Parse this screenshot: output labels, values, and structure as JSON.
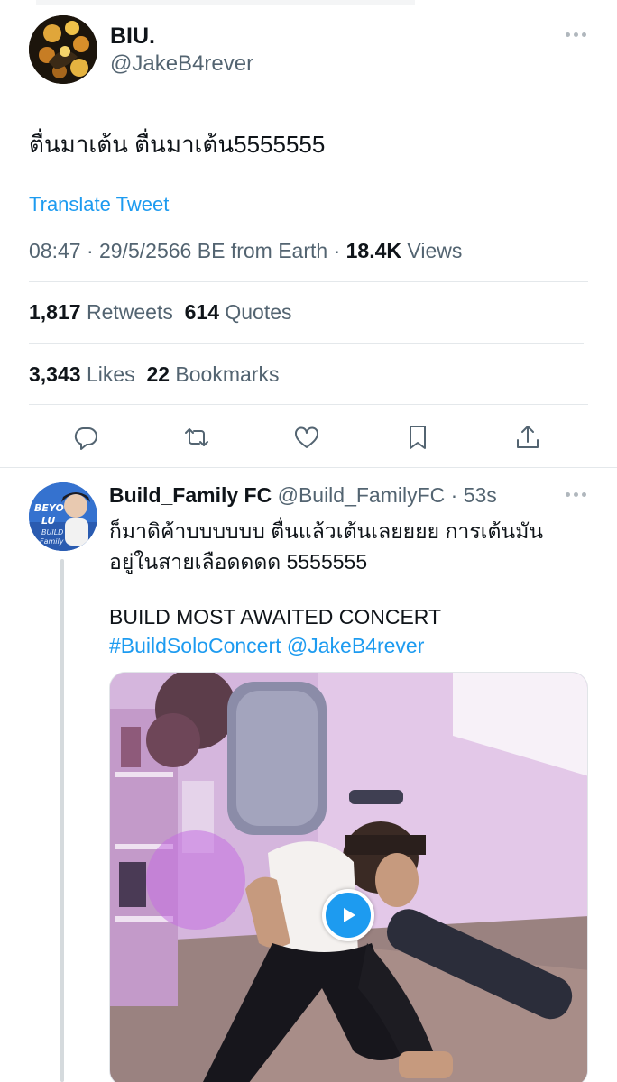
{
  "main_tweet": {
    "display_name": "BIU.",
    "handle": "@JakeB4rever",
    "text": "ตื่นมาเต้น ตื่นมาเต้น5555555",
    "translate_label": "Translate Tweet",
    "time": "08:47",
    "date": "29/5/2566 BE",
    "source": "from Earth",
    "views_count": "18.4K",
    "views_label": "Views",
    "retweets_count": "1,817",
    "retweets_label": "Retweets",
    "quotes_count": "614",
    "quotes_label": "Quotes",
    "likes_count": "3,343",
    "likes_label": "Likes",
    "bookmarks_count": "22",
    "bookmarks_label": "Bookmarks"
  },
  "actions": [
    "reply-icon",
    "retweet-icon",
    "like-icon",
    "bookmark-icon",
    "share-icon"
  ],
  "reply_tweet": {
    "display_name": "Build_Family FC",
    "handle": "@Build_FamilyFC",
    "time_ago": "53s",
    "text_line1": "ก็มาดิค้าบบบบบบ ตื่นแล้วเต้นเลยยยย การเต้นมัน",
    "text_line2": "อยู่ในสายเลือดดดด 5555555",
    "text_line3": "BUILD MOST AWAITED CONCERT",
    "hashtag": "#BuildSoloConcert",
    "mention": "@JakeB4rever"
  },
  "colors": {
    "link": "#1d9bf0",
    "secondary_text": "#536471",
    "primary_text": "#0f1419",
    "divider": "#e4e8eb"
  }
}
